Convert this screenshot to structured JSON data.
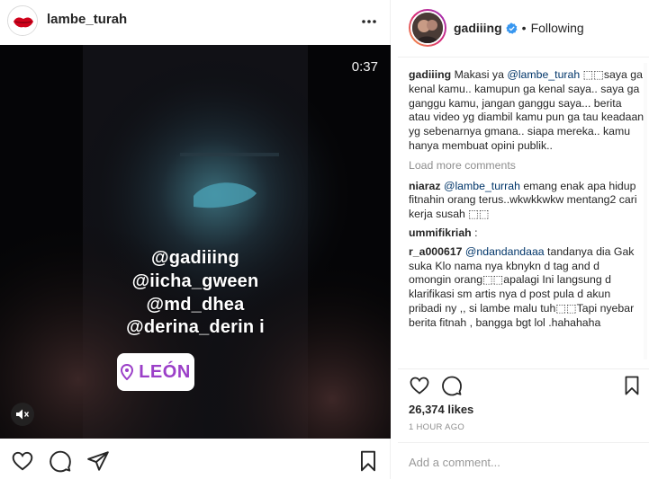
{
  "left_post": {
    "username": "lambe_turah",
    "video_timer": "0:37",
    "tags": [
      "@gadiiing",
      "@iicha_gween",
      "@md_dhea",
      "@derina_derin i"
    ],
    "location": "LEÓN",
    "icons": {
      "more": "more-horizontal-icon",
      "mute": "speaker-muted-icon",
      "like": "heart-icon",
      "comment": "comment-icon",
      "share": "paper-plane-icon",
      "save": "bookmark-icon"
    }
  },
  "right_post": {
    "username": "gadiiing",
    "follow_state": "Following",
    "separator": "•",
    "caption": {
      "user": "gadiiing",
      "pre": "Makasi ya ",
      "mention": "@lambe_turah",
      "post": " ⬚⬚saya ga kenal kamu.. kamupun ga kenal saya.. saya ga ganggu kamu, jangan ganggu saya... berita atau video yg diambil kamu pun ga tau keadaan yg sebenarnya gmana.. siapa mereka.. kamu hanya membuat opini publik.."
    },
    "load_more": "Load more comments",
    "comments": [
      {
        "user": "niaraz",
        "mention": "@lambe_turrah",
        "text": " emang enak apa hidup fitnahin orang terus..wkwkkwkw mentang2 cari kerja susah ⬚⬚"
      },
      {
        "user": "ummifikriah",
        "mention": "",
        "text": " :"
      },
      {
        "user": "r_a000617",
        "mention": "@ndandandaaa",
        "text": " tandanya dia Gak suka Klo nama nya kbnykn d tag and d omongin orang⬚⬚apalagi Ini langsung d klarifikasi sm artis nya d post pula d akun pribadi ny ,, si lambe malu tuh⬚⬚Tapi nyebar berita fitnah , bangga bgt lol .hahahaha"
      }
    ],
    "likes": "26,374 likes",
    "time_ago": "1 HOUR AGO",
    "add_comment_placeholder": "Add a comment...",
    "accent_color": "#3897f0"
  }
}
